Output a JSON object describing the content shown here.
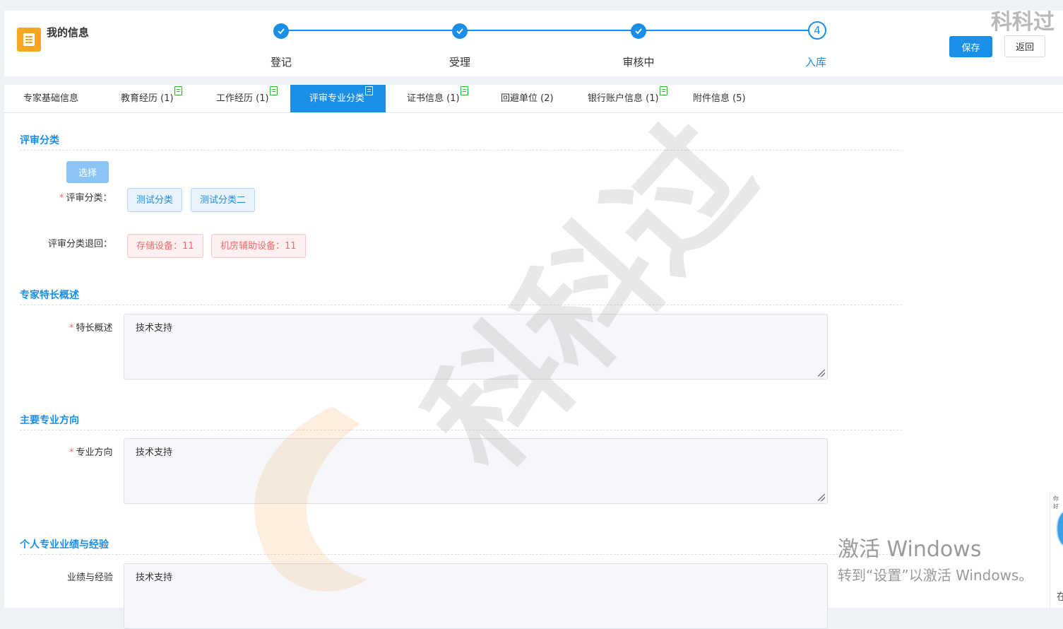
{
  "header": {
    "title": "我的信息",
    "watermark_text": "科科过",
    "save_label": "保存",
    "back_label": "返回"
  },
  "steps": [
    {
      "label": "登记",
      "status": "done"
    },
    {
      "label": "受理",
      "status": "done"
    },
    {
      "label": "审核中",
      "status": "done"
    },
    {
      "label": "入库",
      "status": "current",
      "number": "4"
    }
  ],
  "tabs": [
    {
      "label": "专家基础信息",
      "has_doc_icon": false,
      "active": false
    },
    {
      "label": "教育经历 (1)",
      "has_doc_icon": true,
      "active": false
    },
    {
      "label": "工作经历 (1)",
      "has_doc_icon": true,
      "active": false
    },
    {
      "label": "评审专业分类",
      "has_doc_icon": true,
      "active": true
    },
    {
      "label": "证书信息 (1)",
      "has_doc_icon": true,
      "active": false
    },
    {
      "label": "回避单位 (2)",
      "has_doc_icon": false,
      "active": false
    },
    {
      "label": "银行账户信息 (1)",
      "has_doc_icon": true,
      "active": false
    },
    {
      "label": "附件信息 (5)",
      "has_doc_icon": false,
      "active": false
    }
  ],
  "sections": {
    "review_category": {
      "title": "评审分类",
      "select_label": "选择",
      "category_label": "评审分类：",
      "categories": [
        "测试分类",
        "测试分类二"
      ],
      "returned_label": "评审分类退回：",
      "returned": [
        "存储设备：11",
        "机房辅助设备：11"
      ]
    },
    "expertise": {
      "title": "专家特长概述",
      "label": "特长概述",
      "value": "技术支持"
    },
    "major_direction": {
      "title": "主要专业方向",
      "label": "专业方向",
      "value": "技术支持"
    },
    "experience": {
      "title": "个人专业业绩与经验",
      "label": "业绩与经验",
      "value": "技术支持"
    }
  },
  "windows_activation": {
    "line1": "激活 Windows",
    "line2": "转到“设置”以激活 Windows。"
  },
  "side_widget": {
    "tiny_text": "你好",
    "bottom_char": "在"
  },
  "colors": {
    "primary": "#1b8ee8",
    "warning_icon": "#f5a623",
    "danger": "#f56c6c",
    "doc_icon_green": "#2eb82e"
  }
}
